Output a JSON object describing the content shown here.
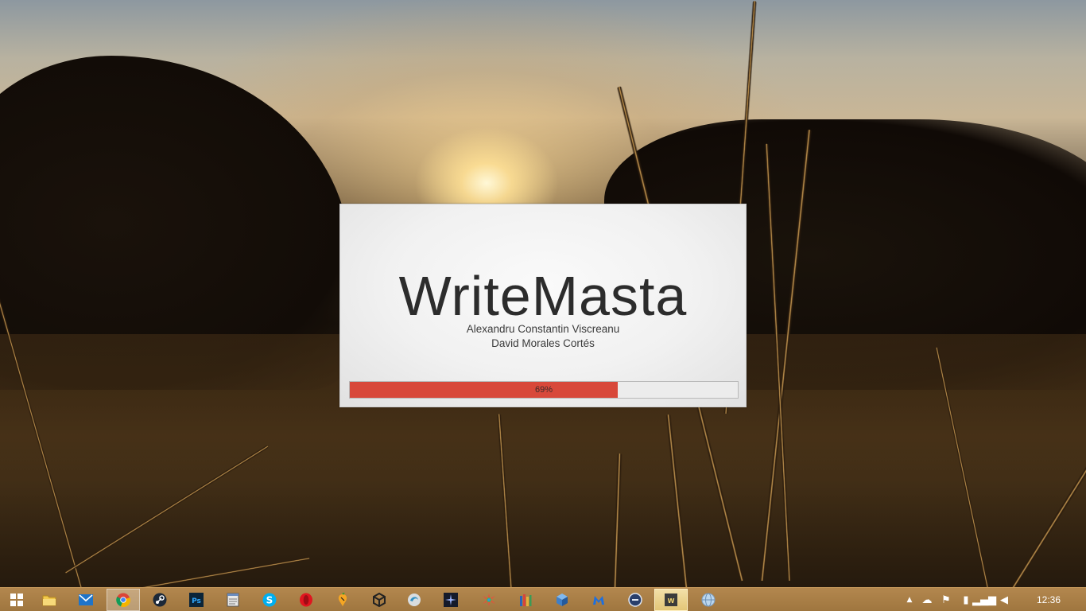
{
  "splash": {
    "app_name": "WriteMasta",
    "authors": [
      "Alexandru Constantin Viscreanu",
      "David Morales Cortés"
    ],
    "progress": {
      "percent": 69,
      "label": "69%",
      "fill_color": "#d8483a"
    }
  },
  "taskbar": {
    "apps": [
      {
        "name": "start-button-icon",
        "glyph": "windows"
      },
      {
        "name": "file-explorer-icon",
        "glyph": "folder"
      },
      {
        "name": "mail-icon",
        "glyph": "envelope"
      },
      {
        "name": "chrome-icon",
        "glyph": "chrome",
        "active": true
      },
      {
        "name": "steam-icon",
        "glyph": "steam"
      },
      {
        "name": "photoshop-icon",
        "glyph": "Ps"
      },
      {
        "name": "notepad-icon",
        "glyph": "notepad"
      },
      {
        "name": "skype-icon",
        "glyph": "S"
      },
      {
        "name": "opera-icon",
        "glyph": "O"
      },
      {
        "name": "fl-studio-icon",
        "glyph": "fruit"
      },
      {
        "name": "unity-icon",
        "glyph": "unity"
      },
      {
        "name": "app-gray-icon",
        "glyph": "swirl"
      },
      {
        "name": "app-dark-icon",
        "glyph": "spark"
      },
      {
        "name": "app-colorful-icon",
        "glyph": "burst"
      },
      {
        "name": "app-books-icon",
        "glyph": "books"
      },
      {
        "name": "virtualbox-icon",
        "glyph": "cube"
      },
      {
        "name": "malwarebytes-icon",
        "glyph": "M"
      },
      {
        "name": "app-circle-icon",
        "glyph": "circle"
      },
      {
        "name": "writemasta-icon",
        "glyph": "WM",
        "focused": true
      },
      {
        "name": "app-globe-icon",
        "glyph": "globe"
      }
    ],
    "tray": [
      {
        "name": "show-hidden-icons-icon",
        "glyph": "▲"
      },
      {
        "name": "onedrive-icon",
        "glyph": "☁"
      },
      {
        "name": "action-center-flag-icon",
        "glyph": "⚑"
      },
      {
        "name": "battery-icon",
        "glyph": "▮"
      },
      {
        "name": "network-signal-icon",
        "glyph": "▂▄▆"
      },
      {
        "name": "volume-icon",
        "glyph": "◀"
      }
    ],
    "clock": "12:36"
  }
}
